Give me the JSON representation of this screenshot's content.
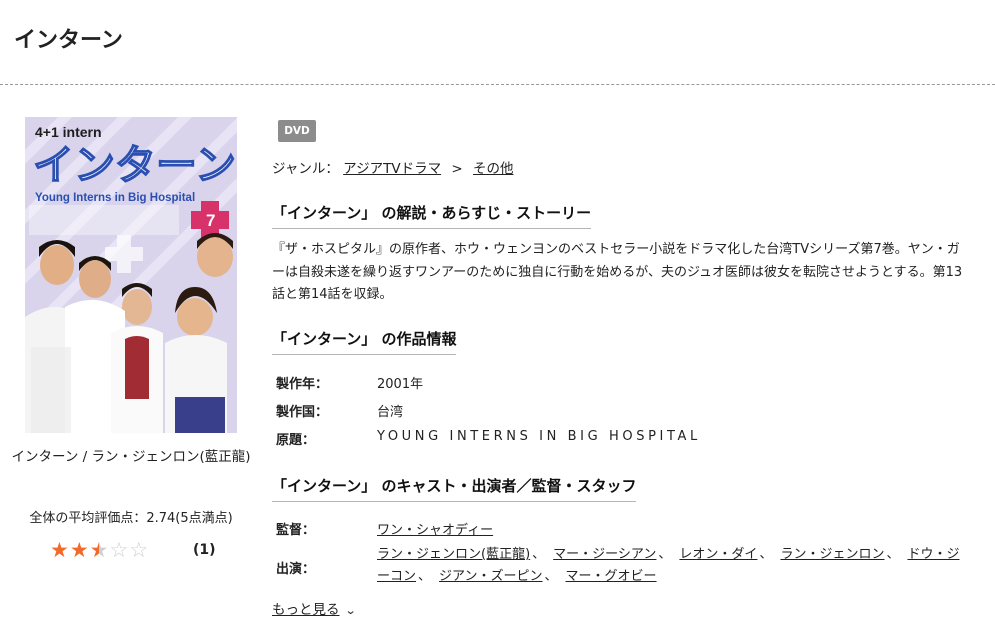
{
  "page": {
    "title": "インターン"
  },
  "cover": {
    "top_text": "4+1 intern",
    "title_text": "インターン",
    "subtitle_text": "Young Interns in Big Hospital",
    "volume": "7",
    "caption": "インターン / ラン・ジェンロン(藍正龍)"
  },
  "rating": {
    "text": "全体の平均評価点：2.74(5点満点)",
    "value": 2.74,
    "max": 5,
    "review_count": "1",
    "review_count_display": "(1)"
  },
  "badge": "DVD",
  "genre": {
    "label": "ジャンル：",
    "items": [
      "アジアTVドラマ",
      "その他"
    ],
    "separator": ">"
  },
  "synopsis": {
    "heading": "「インターン」 の解説・あらすじ・ストーリー",
    "text": "『ザ・ホスピタル』の原作者、ホウ・ウェンヨンのベストセラー小説をドラマ化した台湾TVシリーズ第7巻。ヤン・ガーは自殺未遂を繰り返すワンアーのために独自に行動を始めるが、夫のジュオ医師は彼女を転院させようとする。第13話と第14話を収録。"
  },
  "work_info": {
    "heading": "「インターン」 の作品情報",
    "rows": [
      {
        "label": "製作年：",
        "value": "2001年"
      },
      {
        "label": "製作国：",
        "value": "台湾"
      },
      {
        "label": "原題：",
        "value": "YOUNG INTERNS IN BIG HOSPITAL"
      }
    ]
  },
  "cast": {
    "heading": "「インターン」 のキャスト・出演者／監督・スタッフ",
    "director_label": "監督：",
    "director": "ワン・シャオディー",
    "cast_label": "出演：",
    "members": [
      "ラン・ジェンロン(藍正龍)",
      "マー・ジーシアン",
      "レオン・ダイ",
      "ラン・ジェンロン",
      "ドウ・ジーコン",
      "ジアン・ズーピン",
      "マー・グオビー"
    ],
    "comma": "、"
  },
  "more": {
    "label": "もっと見る",
    "icon": "chevron-down-icon"
  },
  "colors": {
    "star": "#f26a2b",
    "badge": "#8c8c8c",
    "cover_bg": "#d9d4ec"
  }
}
